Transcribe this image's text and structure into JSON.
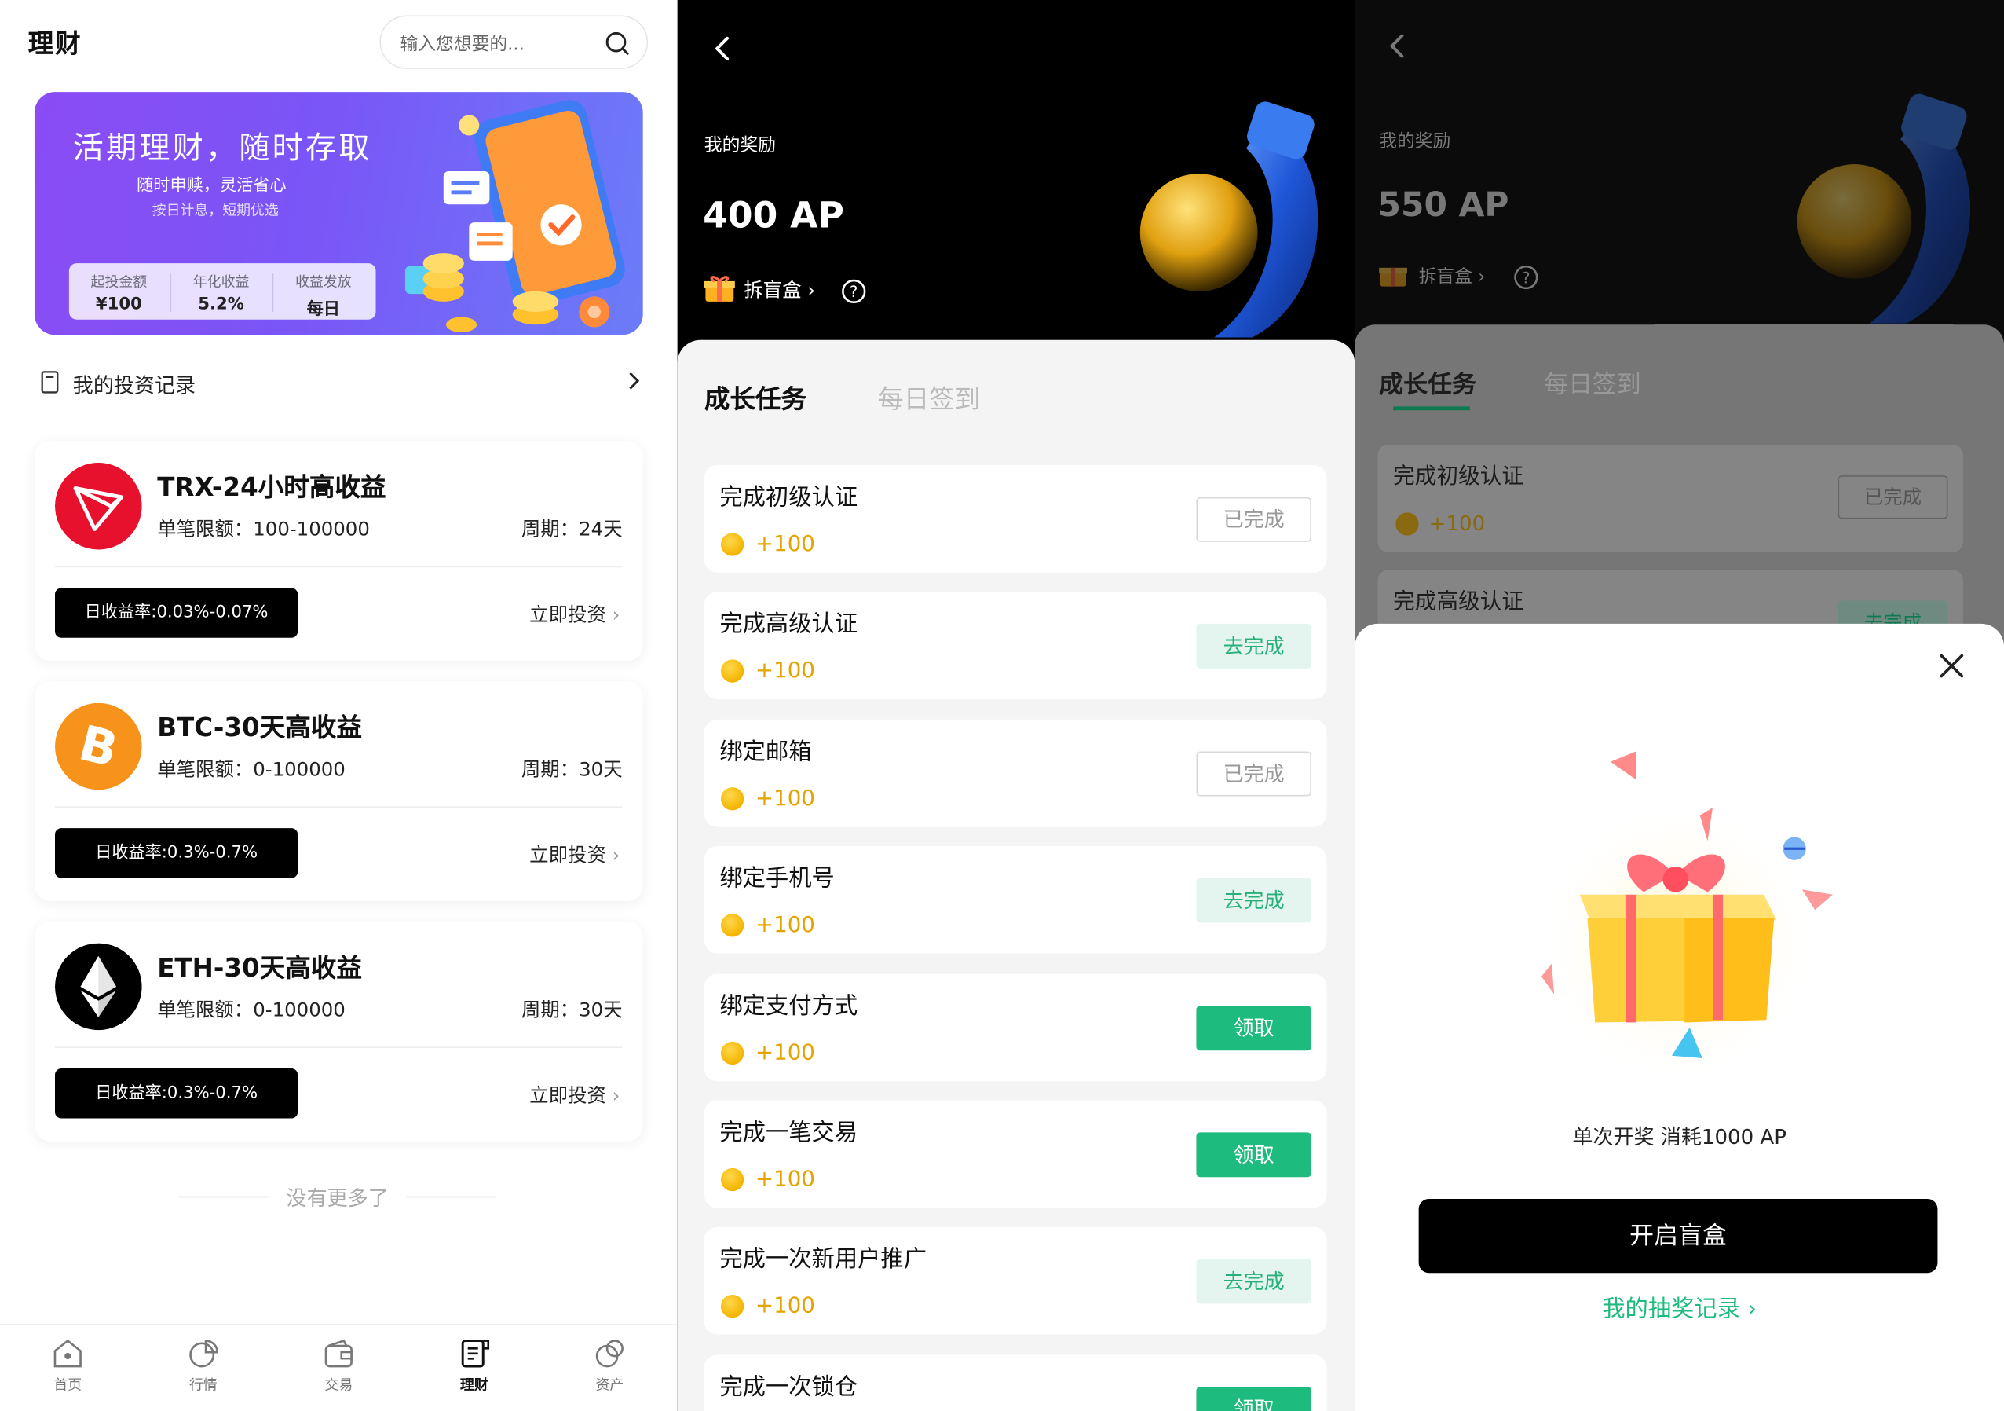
{
  "screen1": {
    "title": "理财",
    "search_placeholder": "输入您想要的...",
    "banner": {
      "title": "活期理财，随时存取",
      "subtitle": "随时申赎，灵活省心",
      "subtitle2": "按日计息，短期优选",
      "stats": [
        {
          "label": "起投金额",
          "value": "¥100"
        },
        {
          "label": "年化收益",
          "value": "5.2%"
        },
        {
          "label": "收益发放",
          "value": "每日"
        }
      ]
    },
    "records_label": "我的投资记录",
    "products": [
      {
        "name": "TRX-24小时高收益",
        "limit": "单笔限额：100-100000",
        "period": "周期：24天",
        "rate": "日收益率:0.03%-0.07%",
        "action": "立即投资",
        "color": "#e8112d"
      },
      {
        "name": "BTC-30天高收益",
        "limit": "单笔限额：0-100000",
        "period": "周期：30天",
        "rate": "日收益率:0.3%-0.7%",
        "action": "立即投资",
        "color": "#f7931a"
      },
      {
        "name": "ETH-30天高收益",
        "limit": "单笔限额：0-100000",
        "period": "周期：30天",
        "rate": "日收益率:0.3%-0.7%",
        "action": "立即投资",
        "color": "#000000"
      }
    ],
    "no_more": "没有更多了",
    "tabs": [
      {
        "label": "首页",
        "icon": "home-icon"
      },
      {
        "label": "行情",
        "icon": "chart-pie-icon"
      },
      {
        "label": "交易",
        "icon": "wallet-icon"
      },
      {
        "label": "理财",
        "icon": "finance-doc-icon",
        "active": true
      },
      {
        "label": "资产",
        "icon": "assets-icon"
      }
    ]
  },
  "screen2": {
    "reward_label": "我的奖励",
    "reward_value": "400 AP",
    "blind_box": "拆盲盒",
    "tab_active": "成长任务",
    "tab_inactive": "每日签到",
    "tasks": [
      {
        "title": "完成初级认证",
        "points": "+100",
        "button": "已完成",
        "state": "done"
      },
      {
        "title": "完成高级认证",
        "points": "+100",
        "button": "去完成",
        "state": "go"
      },
      {
        "title": "绑定邮箱",
        "points": "+100",
        "button": "已完成",
        "state": "done"
      },
      {
        "title": "绑定手机号",
        "points": "+100",
        "button": "去完成",
        "state": "go"
      },
      {
        "title": "绑定支付方式",
        "points": "+100",
        "button": "领取",
        "state": "claim"
      },
      {
        "title": "完成一笔交易",
        "points": "+100",
        "button": "领取",
        "state": "claim"
      },
      {
        "title": "完成一次新用户推广",
        "points": "+100",
        "button": "去完成",
        "state": "go"
      },
      {
        "title": "完成一次锁仓",
        "points": "",
        "button": "领取",
        "state": "claim"
      }
    ]
  },
  "screen3": {
    "reward_label": "我的奖励",
    "reward_value": "550 AP",
    "blind_box": "拆盲盒",
    "tab_active": "成长任务",
    "tab_inactive": "每日签到",
    "bg_tasks": [
      {
        "title": "完成初级认证",
        "points": "+100",
        "button": "已完成"
      },
      {
        "title": "完成高级认证",
        "button": "去完成"
      }
    ],
    "modal": {
      "cost_text": "单次开奖 消耗1000 AP",
      "open_button": "开启盲盒",
      "record_link": "我的抽奖记录"
    }
  },
  "colors": {
    "accent_green": "#1ebb7e",
    "banner_purple": "#7a55f7",
    "coin_gold": "#e5a300"
  }
}
